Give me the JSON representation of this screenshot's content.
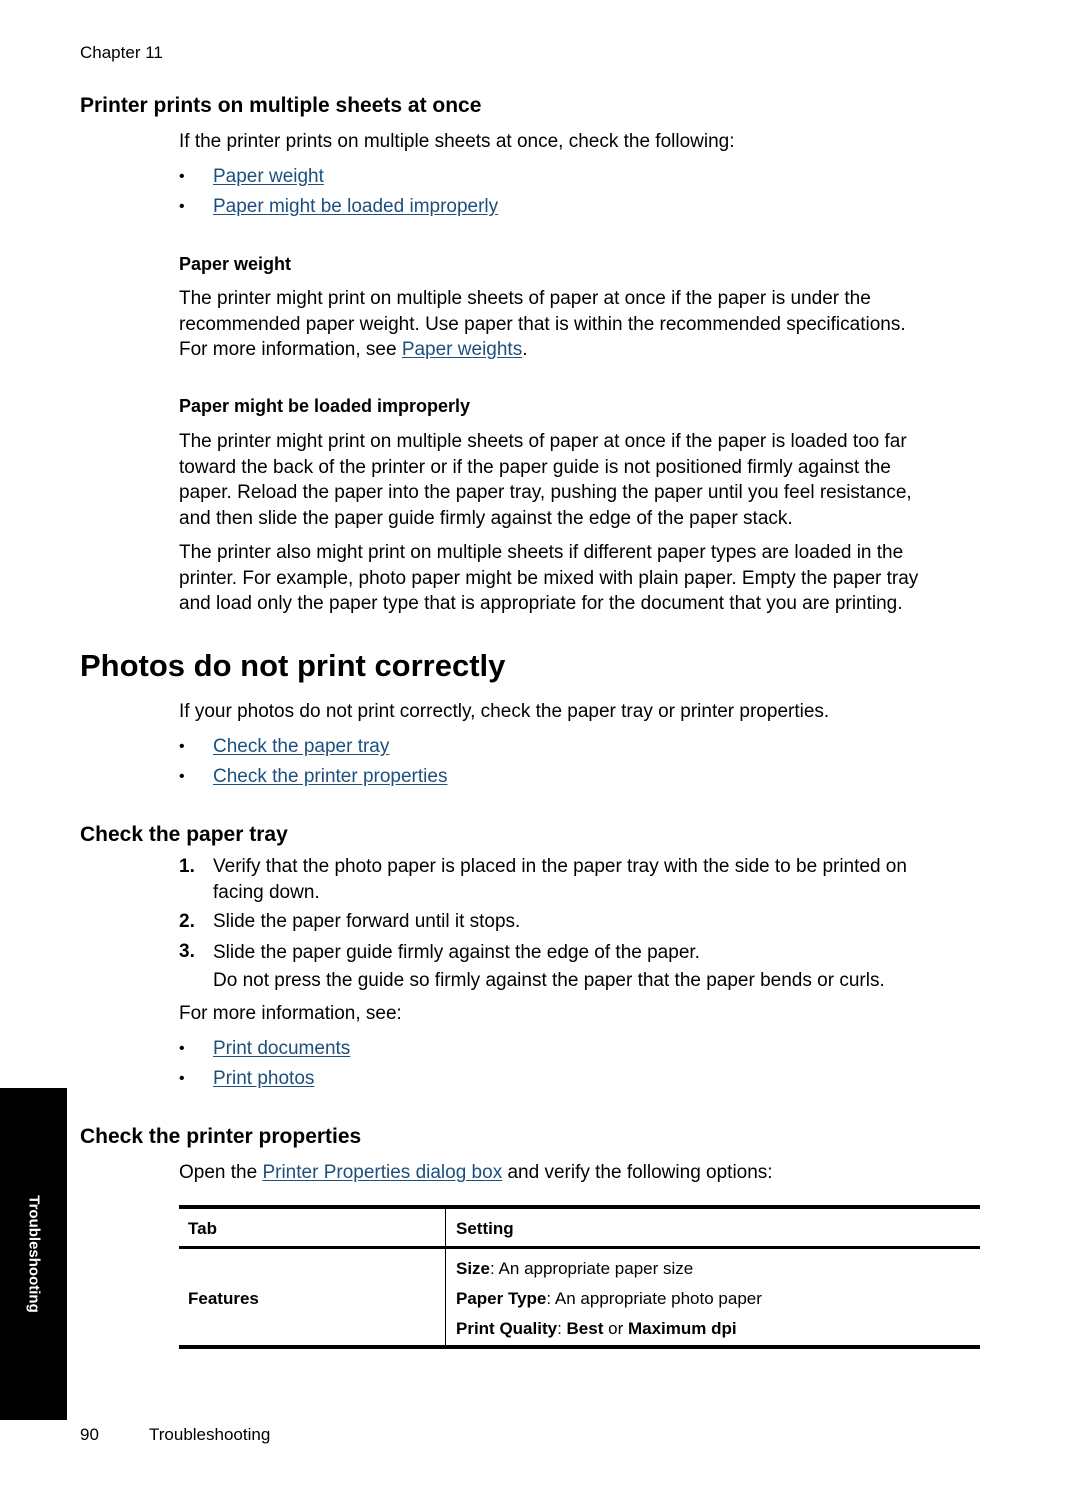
{
  "running_head": "Chapter 11",
  "section1": {
    "heading": "Printer prints on multiple sheets at once",
    "intro": "If the printer prints on multiple sheets at once, check the following:",
    "links": [
      "Paper weight",
      "Paper might be loaded improperly"
    ],
    "sub1": {
      "heading": "Paper weight",
      "lines": [
        "The printer might print on multiple sheets of paper at once if the paper is under the",
        "recommended paper weight. Use paper that is within the recommended specifications."
      ],
      "line3_prefix": "For more information, see ",
      "line3_link": "Paper weights",
      "line3_suffix": "."
    },
    "sub2": {
      "heading": "Paper might be loaded improperly",
      "para1": [
        "The printer might print on multiple sheets of paper at once if the paper is loaded too far",
        "toward the back of the printer or if the paper guide is not positioned firmly against the",
        "paper. Reload the paper into the paper tray, pushing the paper until you feel resistance,",
        "and then slide the paper guide firmly against the edge of the paper stack."
      ],
      "para2": [
        "The printer also might print on multiple sheets if different paper types are loaded in the",
        "printer. For example, photo paper might be mixed with plain paper. Empty the paper tray",
        "and load only the paper type that is appropriate for the document that you are printing."
      ]
    }
  },
  "section2": {
    "heading": "Photos do not print correctly",
    "intro": "If your photos do not print correctly, check the paper tray or printer properties.",
    "links": [
      "Check the paper tray",
      "Check the printer properties"
    ]
  },
  "section3": {
    "heading": "Check the paper tray",
    "steps": [
      {
        "num": "1.",
        "lines": [
          "Verify that the photo paper is placed in the paper tray with the side to be printed on",
          "facing down."
        ]
      },
      {
        "num": "2.",
        "lines": [
          "Slide the paper forward until it stops."
        ]
      },
      {
        "num": "3.",
        "lines": [
          "Slide the paper guide firmly against the edge of the paper.",
          "Do not press the guide so firmly against the paper that the paper bends or curls."
        ]
      }
    ],
    "more_info": "For more information, see:",
    "links": [
      "Print documents",
      "Print photos"
    ]
  },
  "section4": {
    "heading": "Check the printer properties",
    "intro_prefix": "Open the ",
    "intro_link": "Printer Properties dialog box",
    "intro_suffix": " and verify the following options:",
    "table": {
      "headers": [
        "Tab",
        "Setting"
      ],
      "row": {
        "tab": "Features",
        "settings": [
          {
            "label": "Size",
            "sep": ": ",
            "value": "An appropriate paper size"
          },
          {
            "label": "Paper Type",
            "sep": ": ",
            "value": "An appropriate photo paper"
          },
          {
            "label": "Print Quality",
            "sep": ": ",
            "value_bold1": "Best",
            "value_mid": " or ",
            "value_bold2": "Maximum dpi"
          }
        ]
      }
    }
  },
  "side_tab": "Troubleshooting",
  "footer": {
    "page": "90",
    "title": "Troubleshooting"
  },
  "colors": {
    "link": "#1c4f7e",
    "tab_bg": "#000000",
    "tab_text": "#ffffff"
  }
}
